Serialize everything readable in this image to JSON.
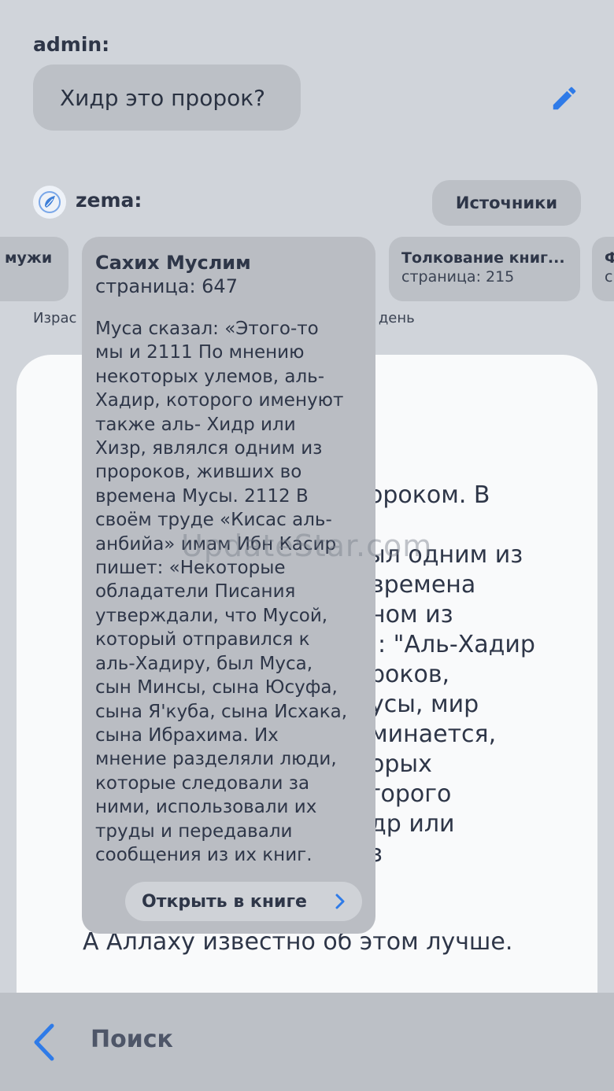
{
  "chat": {
    "admin_label": "admin:",
    "question": "Хидр это пророк?",
    "zema_label": "zema:",
    "sources_button": "Источники"
  },
  "source_cards": [
    {
      "title": "мужи",
      "page": ""
    },
    {
      "title": "Толкование книг...",
      "page": "страница: 215"
    },
    {
      "title": "Ф",
      "page": "с"
    }
  ],
  "snippet": {
    "left": "Израс",
    "right": "день"
  },
  "answer_lines": [
    "ороком. В",
    "ыл одним из",
    "времена",
    "ном из",
    ": \"Аль-Хадир",
    "роков,",
    "усы, мир",
    "минается,",
    "орых",
    "торого",
    "др или",
    "з",
    "А Аллаху известно об этом лучше."
  ],
  "watermark": "UpdateStar.com",
  "popup": {
    "title": "Сахих Муслим",
    "page": "страница: 647",
    "body_lines": [
      "Муса сказал: «Этого-то",
      "мы и 2111 По мнению",
      "некоторых улемов, аль-",
      "Хадир, которого именуют",
      "также аль- Хидр или",
      "Хизр, являлся одним из",
      "пророков, живших во",
      "времена Мусы. 2112 В",
      "своём труде «Кисас аль-",
      "анбийа» имам Ибн Касир",
      "пишет: «Некоторые",
      "обладатели Писания",
      "утверждали, что Мусой,",
      "который отправился к",
      "аль-Хадиру, был Муса,",
      "сын Минсы, сына Юсуфа,",
      "сына Я'куба, сына Исхака,",
      "сына Ибрахима. Их",
      "мнение разделяли люди,",
      "которые следовали за",
      "ними, использовали их",
      "труды и передавали",
      "сообщения из их книг."
    ],
    "open_button": "Открыть в книге"
  },
  "bottom_bar": {
    "title": "Поиск"
  },
  "colors": {
    "accent": "#2f7be8",
    "background": "#d0d4da",
    "panel": "#f9fafb",
    "popup": "#babdc3"
  },
  "icons": [
    "pencil-icon",
    "zema-logo-icon",
    "chevron-right-icon",
    "back-arrow-icon"
  ]
}
